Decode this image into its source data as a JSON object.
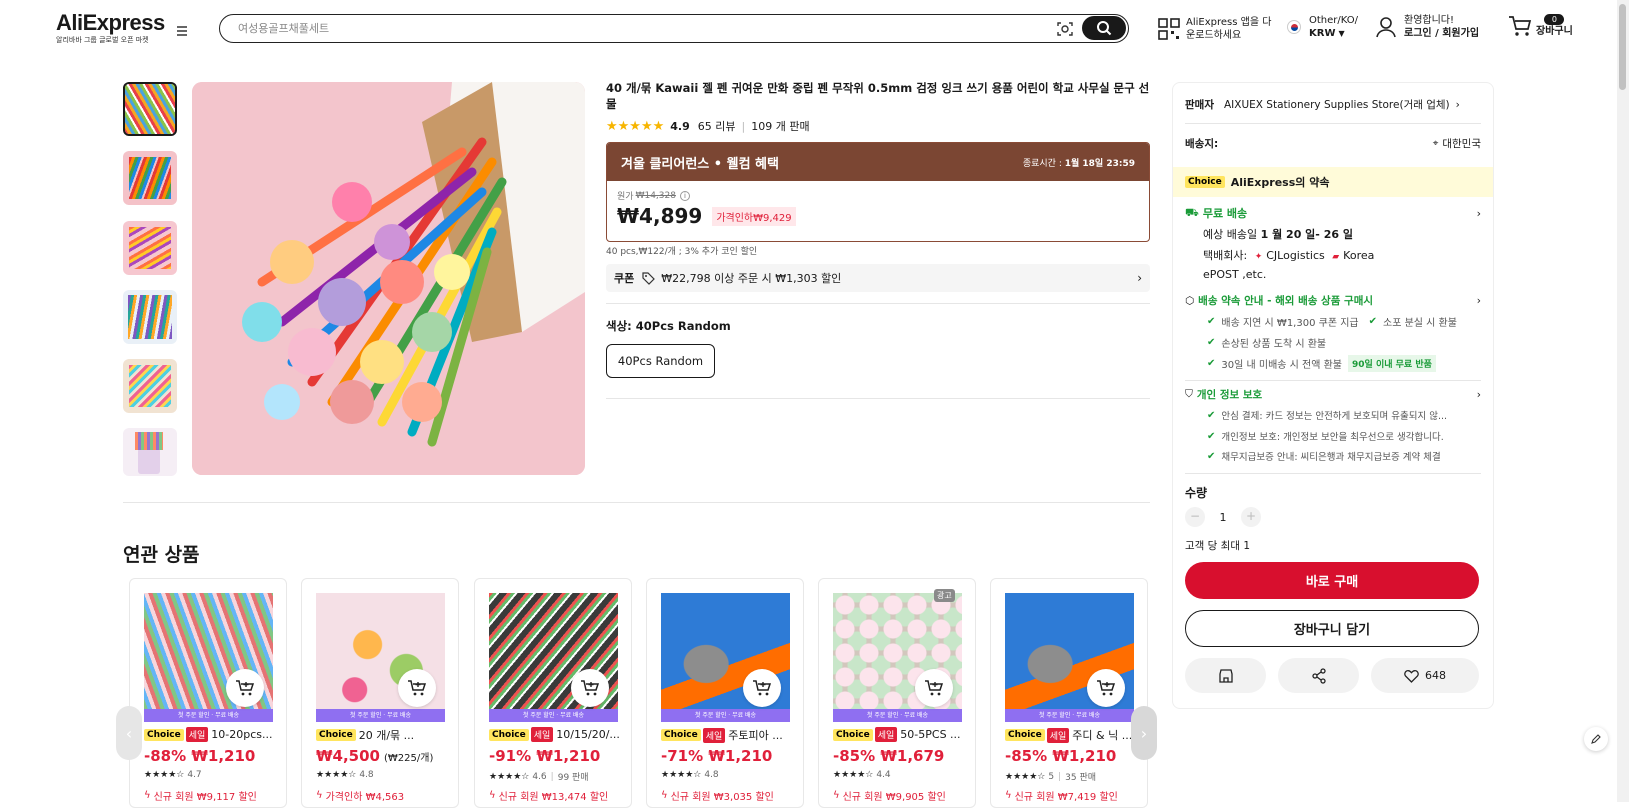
{
  "header": {
    "logo": "AliExpress",
    "logo_sub": "알리바바 그룹 글로벌 오픈 마켓",
    "search_placeholder": "여성용골프채풀세트",
    "app_line1": "AliExpress 앱을 다",
    "app_line2": "운로드하세요",
    "region_line1": "Other/KO/",
    "currency": "KRW",
    "welcome": "환영합니다!",
    "login": "로그인 / 회원가입",
    "cart_count": "0",
    "cart_label": "장바구니"
  },
  "product": {
    "title": "40 개/묶 Kawaii 젤 펜 귀여운 만화 중립 펜 무작위 0.5mm 검정 잉크 쓰기 용품 어린이 학교 사무실 문구 선물",
    "rating": "4.9",
    "reviews": "65 리뷰",
    "sold": "109 개 판매",
    "promo_title": "겨울 클리어런스 • 웰컴 혜택",
    "promo_end_label": "종료시간 :",
    "promo_end": "1월 18일 23:59",
    "orig_label": "원가",
    "orig_price": "₩14,328",
    "price": "₩4,899",
    "discount_tag": "가격인하₩9,429",
    "unit_info": "40 pcs,₩122/개 ; 3% 추가 코인 할인",
    "coupon_label": "쿠폰",
    "coupon_text": "₩22,798 이상 주문 시 ₩1,303 할인",
    "color_label": "색상:",
    "color_value": "40Pcs Random",
    "variant": "40Pcs Random"
  },
  "related": {
    "title": "연관 상품",
    "band": "첫 주문 할인 · 무료 배송",
    "choice": "Choice",
    "sale": "세일",
    "ad": "광고",
    "items": [
      {
        "name": "10-20pcs...",
        "sale": true,
        "price": "-88% ₩1,210",
        "unit": "",
        "rating": "4.7",
        "sold": "",
        "promo": "신규 회원 ₩9,117 할인"
      },
      {
        "name": "20 개/묶 ...",
        "sale": false,
        "price": "₩4,500",
        "unit": "(₩225/개)",
        "rating": "4.8",
        "sold": "",
        "promo": "가격인하 ₩4,563"
      },
      {
        "name": "10/15/20/...",
        "sale": true,
        "price": "-91% ₩1,210",
        "unit": "",
        "rating": "4.6",
        "sold": "99 판매",
        "promo": "신규 회원 ₩13,474 할인"
      },
      {
        "name": "주토피아 ...",
        "sale": true,
        "price": "-71% ₩1,210",
        "unit": "",
        "rating": "4.8",
        "sold": "",
        "promo": "신규 회원 ₩3,035 할인"
      },
      {
        "name": "50-5PCS ...",
        "sale": true,
        "price": "-85% ₩1,679",
        "unit": "",
        "rating": "4.4",
        "sold": "",
        "promo": "신규 회원 ₩9,905 할인"
      },
      {
        "name": "주디 & 닉 ...",
        "sale": true,
        "price": "-85% ₩1,210",
        "unit": "",
        "rating": "5",
        "sold": "35 판매",
        "promo": "신규 회원 ₩7,419 할인"
      }
    ]
  },
  "sidebar": {
    "seller_label": "판매자",
    "seller_name": "AIXUEX Stationery Supplies Store(거래 업체)",
    "ship_to_label": "배송지:",
    "ship_to": "대한민국",
    "choice_badge": "Choice",
    "promise": "AliExpress의 약속",
    "free_ship": "무료 배송",
    "eta_label": "예상 배송일",
    "eta": "1 월 20 일- 26 일",
    "carrier_label": "택배회사:",
    "carrier1": "CJLogistics",
    "carrier2": "Korea",
    "carrier3": "ePOST ,etc.",
    "guarantee_title": "배송 약속 안내 - 해외 배송 상품 구매시",
    "g1": "배송 지연 시 ₩1,300 쿠폰 지급",
    "g2": "소포 분실 시 환불",
    "g3": "손상된 상품 도착 시 환불",
    "g4": "30일 내 미배송 시 전액 환불",
    "g4_badge": "90일 이내 무료 반품",
    "privacy_title": "개인 정보 보호",
    "p1": "안심 결제: 카드 정보는 안전하게 보호되며 유출되지 않...",
    "p2": "개인정보 보호: 개인정보 보안을 최우선으로 생각합니다.",
    "p3": "채무지급보증 안내: 씨티은행과 채무지급보증 계약 체결",
    "qty_label": "수량",
    "qty": "1",
    "max_per": "고객 당 최대 1",
    "buy_now": "바로 구매",
    "add_cart": "장바구니 담기",
    "wish_count": "648"
  }
}
